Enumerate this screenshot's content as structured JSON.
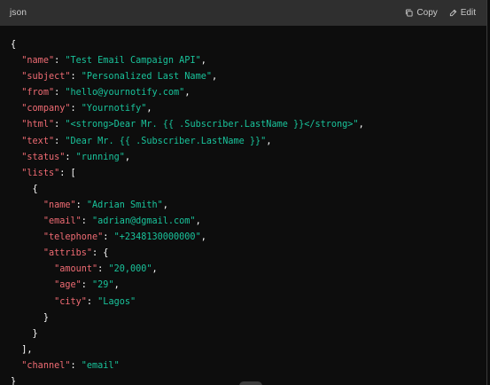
{
  "header": {
    "language": "json",
    "copy_label": "Copy",
    "edit_label": "Edit",
    "copy_icon": "copy-icon",
    "edit_icon": "edit-icon"
  },
  "code_lines": [
    {
      "indent": "",
      "open": "{",
      "key": "",
      "sep": "",
      "value": "",
      "close": ""
    },
    {
      "indent": "  ",
      "open": "",
      "key": "\"name\"",
      "sep": ": ",
      "value": "\"Test Email Campaign API\"",
      "close": ","
    },
    {
      "indent": "  ",
      "open": "",
      "key": "\"subject\"",
      "sep": ": ",
      "value": "\"Personalized Last Name\"",
      "close": ","
    },
    {
      "indent": "  ",
      "open": "",
      "key": "\"from\"",
      "sep": ": ",
      "value": "\"hello@yournotify.com\"",
      "close": ","
    },
    {
      "indent": "  ",
      "open": "",
      "key": "\"company\"",
      "sep": ": ",
      "value": "\"Yournotify\"",
      "close": ","
    },
    {
      "indent": "  ",
      "open": "",
      "key": "\"html\"",
      "sep": ": ",
      "value": "\"<strong>Dear Mr. {{ .Subscriber.LastName }}</strong>\"",
      "close": ","
    },
    {
      "indent": "  ",
      "open": "",
      "key": "\"text\"",
      "sep": ": ",
      "value": "\"Dear Mr. {{ .Subscriber.LastName }}\"",
      "close": ","
    },
    {
      "indent": "  ",
      "open": "",
      "key": "\"status\"",
      "sep": ": ",
      "value": "\"running\"",
      "close": ","
    },
    {
      "indent": "  ",
      "open": "",
      "key": "\"lists\"",
      "sep": ": ",
      "value": "",
      "close": "["
    },
    {
      "indent": "    ",
      "open": "{",
      "key": "",
      "sep": "",
      "value": "",
      "close": ""
    },
    {
      "indent": "      ",
      "open": "",
      "key": "\"name\"",
      "sep": ": ",
      "value": "\"Adrian Smith\"",
      "close": ","
    },
    {
      "indent": "      ",
      "open": "",
      "key": "\"email\"",
      "sep": ": ",
      "value": "\"adrian@dgmail.com\"",
      "close": ","
    },
    {
      "indent": "      ",
      "open": "",
      "key": "\"telephone\"",
      "sep": ": ",
      "value": "\"+2348130000000\"",
      "close": ","
    },
    {
      "indent": "      ",
      "open": "",
      "key": "\"attribs\"",
      "sep": ": ",
      "value": "",
      "close": "{"
    },
    {
      "indent": "        ",
      "open": "",
      "key": "\"amount\"",
      "sep": ": ",
      "value": "\"20,000\"",
      "close": ","
    },
    {
      "indent": "        ",
      "open": "",
      "key": "\"age\"",
      "sep": ": ",
      "value": "\"29\"",
      "close": ","
    },
    {
      "indent": "        ",
      "open": "",
      "key": "\"city\"",
      "sep": ": ",
      "value": "\"Lagos\"",
      "close": ""
    },
    {
      "indent": "      ",
      "open": "}",
      "key": "",
      "sep": "",
      "value": "",
      "close": ""
    },
    {
      "indent": "    ",
      "open": "}",
      "key": "",
      "sep": "",
      "value": "",
      "close": ""
    },
    {
      "indent": "  ",
      "open": "]",
      "key": "",
      "sep": "",
      "value": "",
      "close": ","
    },
    {
      "indent": "  ",
      "open": "",
      "key": "\"channel\"",
      "sep": ": ",
      "value": "\"email\"",
      "close": ""
    },
    {
      "indent": "",
      "open": "}",
      "key": "",
      "sep": "",
      "value": "",
      "close": ""
    }
  ],
  "colors": {
    "key": "#ef6b73",
    "string": "#19c39b",
    "punctuation": "#ffffff",
    "header_bg": "#2f2f2f",
    "code_bg": "#0d0d0d"
  }
}
